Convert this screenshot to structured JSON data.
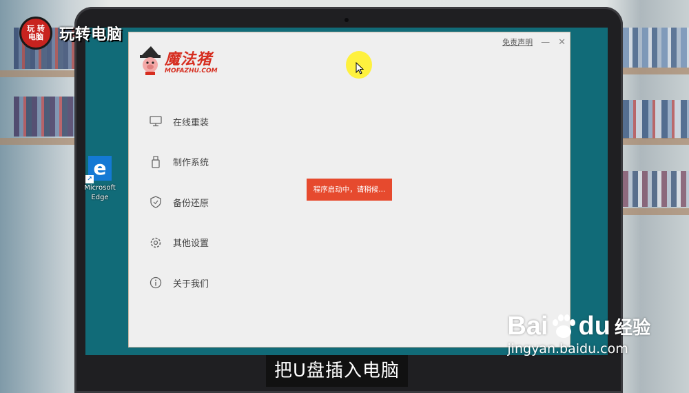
{
  "watermark": {
    "badge_line1": "玩 转",
    "badge_line2": "电脑",
    "title": "玩转电脑"
  },
  "desktop": {
    "icons": [
      {
        "label": "Microsoft Edge",
        "icon": "edge-icon"
      }
    ]
  },
  "app": {
    "brand_cn": "魔法猪",
    "brand_en": "MOFAZHU.COM",
    "disclaimer": "免责声明",
    "minimize": "—",
    "close": "✕",
    "menu": [
      {
        "label": "在线重装",
        "icon": "monitor-icon"
      },
      {
        "label": "制作系统",
        "icon": "usb-drive-icon"
      },
      {
        "label": "备份还原",
        "icon": "shield-icon"
      },
      {
        "label": "其他设置",
        "icon": "gear-icon"
      },
      {
        "label": "关于我们",
        "icon": "info-icon"
      }
    ],
    "toast": "程序启动中，请稍候..."
  },
  "caption": "把U盘插入电脑",
  "baidu": {
    "logo_left": "Bai",
    "logo_right": "du",
    "logo_cn": "经验",
    "url": "jingyan.baidu.com"
  },
  "colors": {
    "accent_red": "#e64a2e",
    "desktop_teal": "#116b78",
    "brand_red": "#d62d1f"
  }
}
